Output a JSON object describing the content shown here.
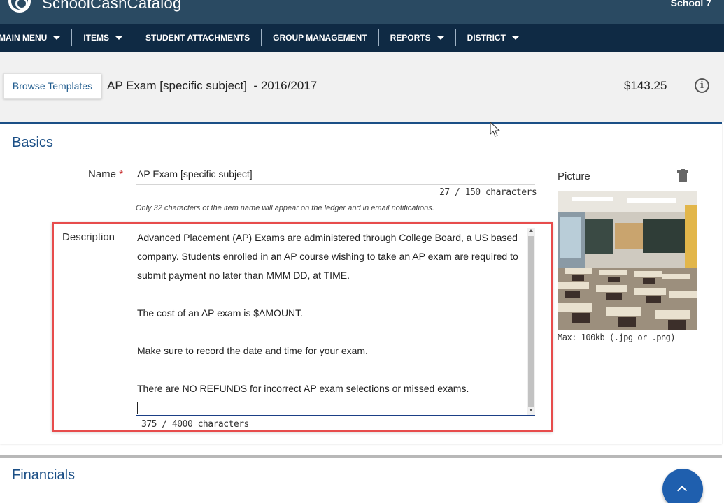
{
  "header": {
    "brand": "SchoolCashCatalog",
    "school": "School 7"
  },
  "nav": {
    "items": [
      {
        "label": "MAIN MENU",
        "dropdown": true
      },
      {
        "label": "ITEMS",
        "dropdown": true
      },
      {
        "label": "STUDENT ATTACHMENTS",
        "dropdown": false
      },
      {
        "label": "GROUP MANAGEMENT",
        "dropdown": false
      },
      {
        "label": "REPORTS",
        "dropdown": true
      },
      {
        "label": "DISTRICT",
        "dropdown": true
      }
    ]
  },
  "subheader": {
    "browse_label": "Browse Templates",
    "title": "AP Exam [specific subject]  - 2016/2017",
    "price": "$143.25",
    "info_icon": "info-icon"
  },
  "basics": {
    "title": "Basics",
    "name_label": "Name",
    "required_mark": "*",
    "name_value": "AP Exam [specific subject]",
    "name_count": "27 / 150  characters",
    "name_hint": "Only 32 characters of the item name will appear on the ledger and in email notifications.",
    "description_label": "Description",
    "description_value": "Advanced Placement (AP) Exams are administered through College Board, a US based company. Students enrolled in an AP course wishing to take an AP exam are required to submit payment no later than MMM DD, at TIME.\n\nThe cost of an AP exam is $AMOUNT.\n\nMake sure to record the date and time for your exam.\n\nThere are NO REFUNDS for incorrect AP exam selections or missed exams.",
    "description_count": "375 / 4000  characters",
    "picture_label": "Picture",
    "picture_hint": "Max: 100kb (.jpg or .png)",
    "picture_icon": "trash-icon",
    "highlight_color": "#e74c4c"
  },
  "financials": {
    "title": "Financials"
  },
  "colors": {
    "topbar": "#2a4a62",
    "navbar": "#0f2a44",
    "accent": "#1b4f86",
    "fab": "#1f5fae"
  }
}
